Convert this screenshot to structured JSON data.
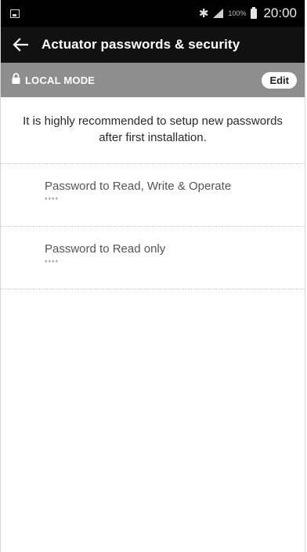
{
  "status_bar": {
    "battery_percent": "100%",
    "time": "20:00"
  },
  "app_bar": {
    "title": "Actuator passwords & security"
  },
  "mode_bar": {
    "mode_label": "LOCAL MODE",
    "edit_label": "Edit"
  },
  "notice": {
    "text": "It is highly recommended to setup new passwords after first installation."
  },
  "passwords": [
    {
      "label": "Password to Read, Write & Operate",
      "value": "****"
    },
    {
      "label": "Password to Read only",
      "value": "****"
    }
  ]
}
